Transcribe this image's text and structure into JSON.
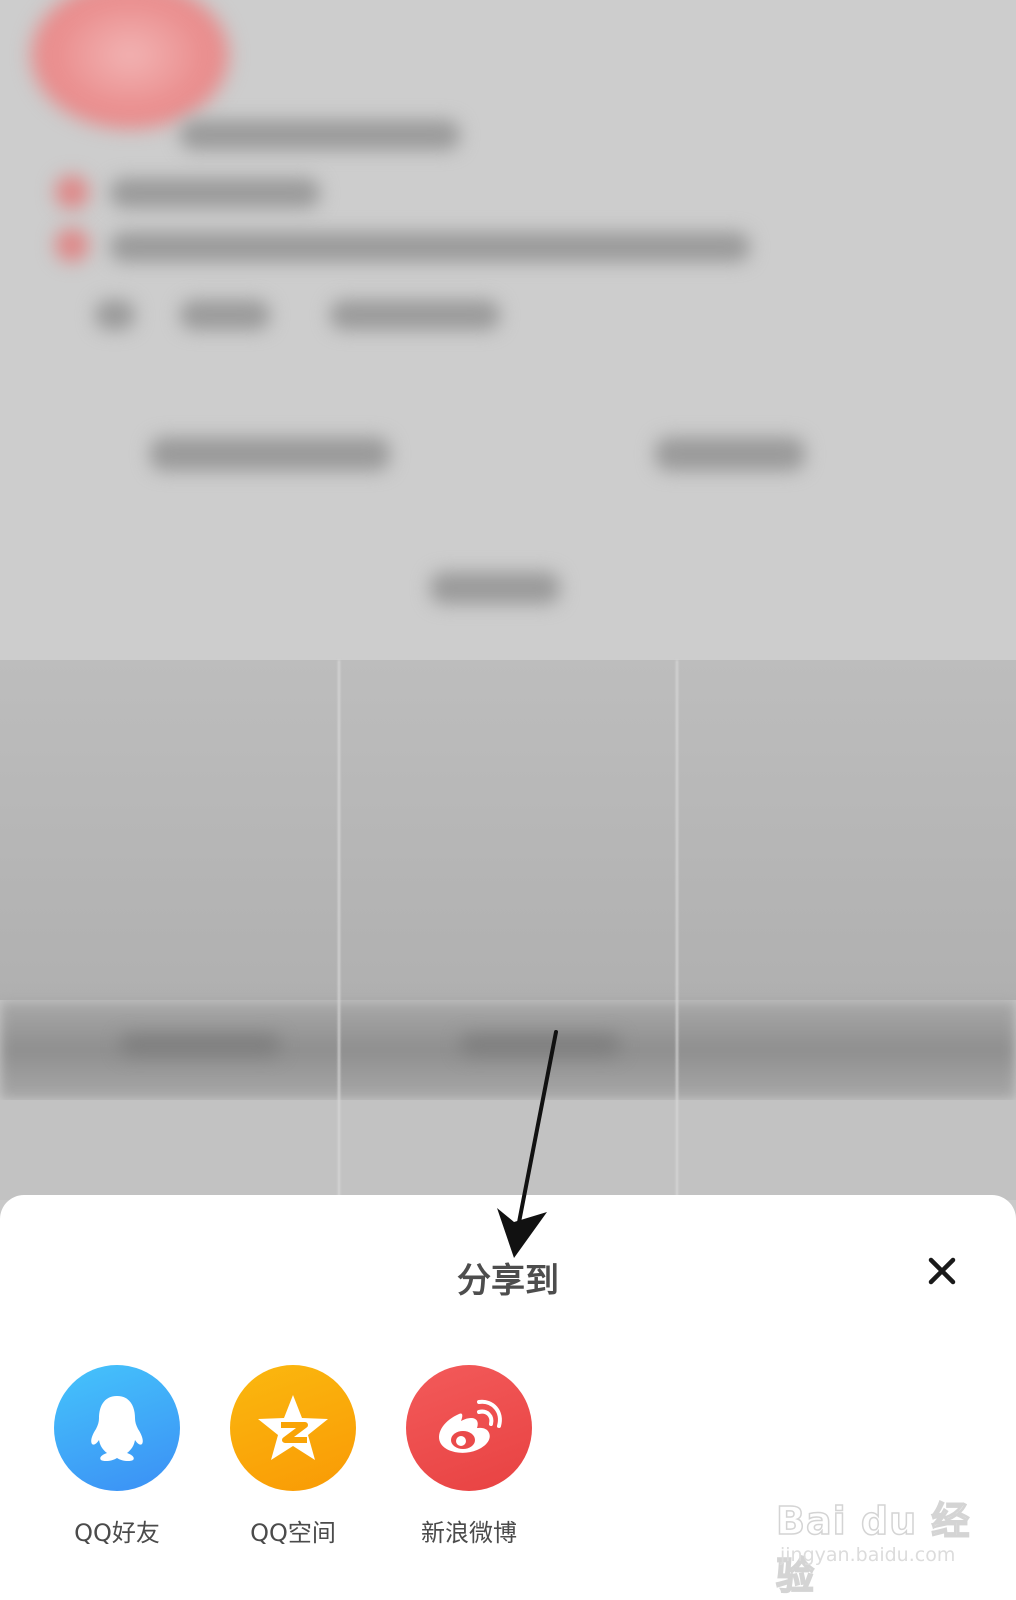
{
  "share_sheet": {
    "title": "分享到",
    "close_symbol": "✕",
    "items": [
      {
        "label": "QQ好友",
        "icon": "qq-penguin-icon",
        "color": "#3f9ff8"
      },
      {
        "label": "QQ空间",
        "icon": "qzone-star-icon",
        "color": "#fbaa0a"
      },
      {
        "label": "新浪微博",
        "icon": "weibo-icon",
        "color": "#ee4b4b"
      }
    ]
  },
  "watermark": {
    "brand": "Bai du 经验",
    "url": "jingyan.baidu.com"
  },
  "colors": {
    "overlay_gray": "#c9c9c9",
    "sheet_bg": "#ffffff",
    "title_text": "#4d4d4d"
  }
}
